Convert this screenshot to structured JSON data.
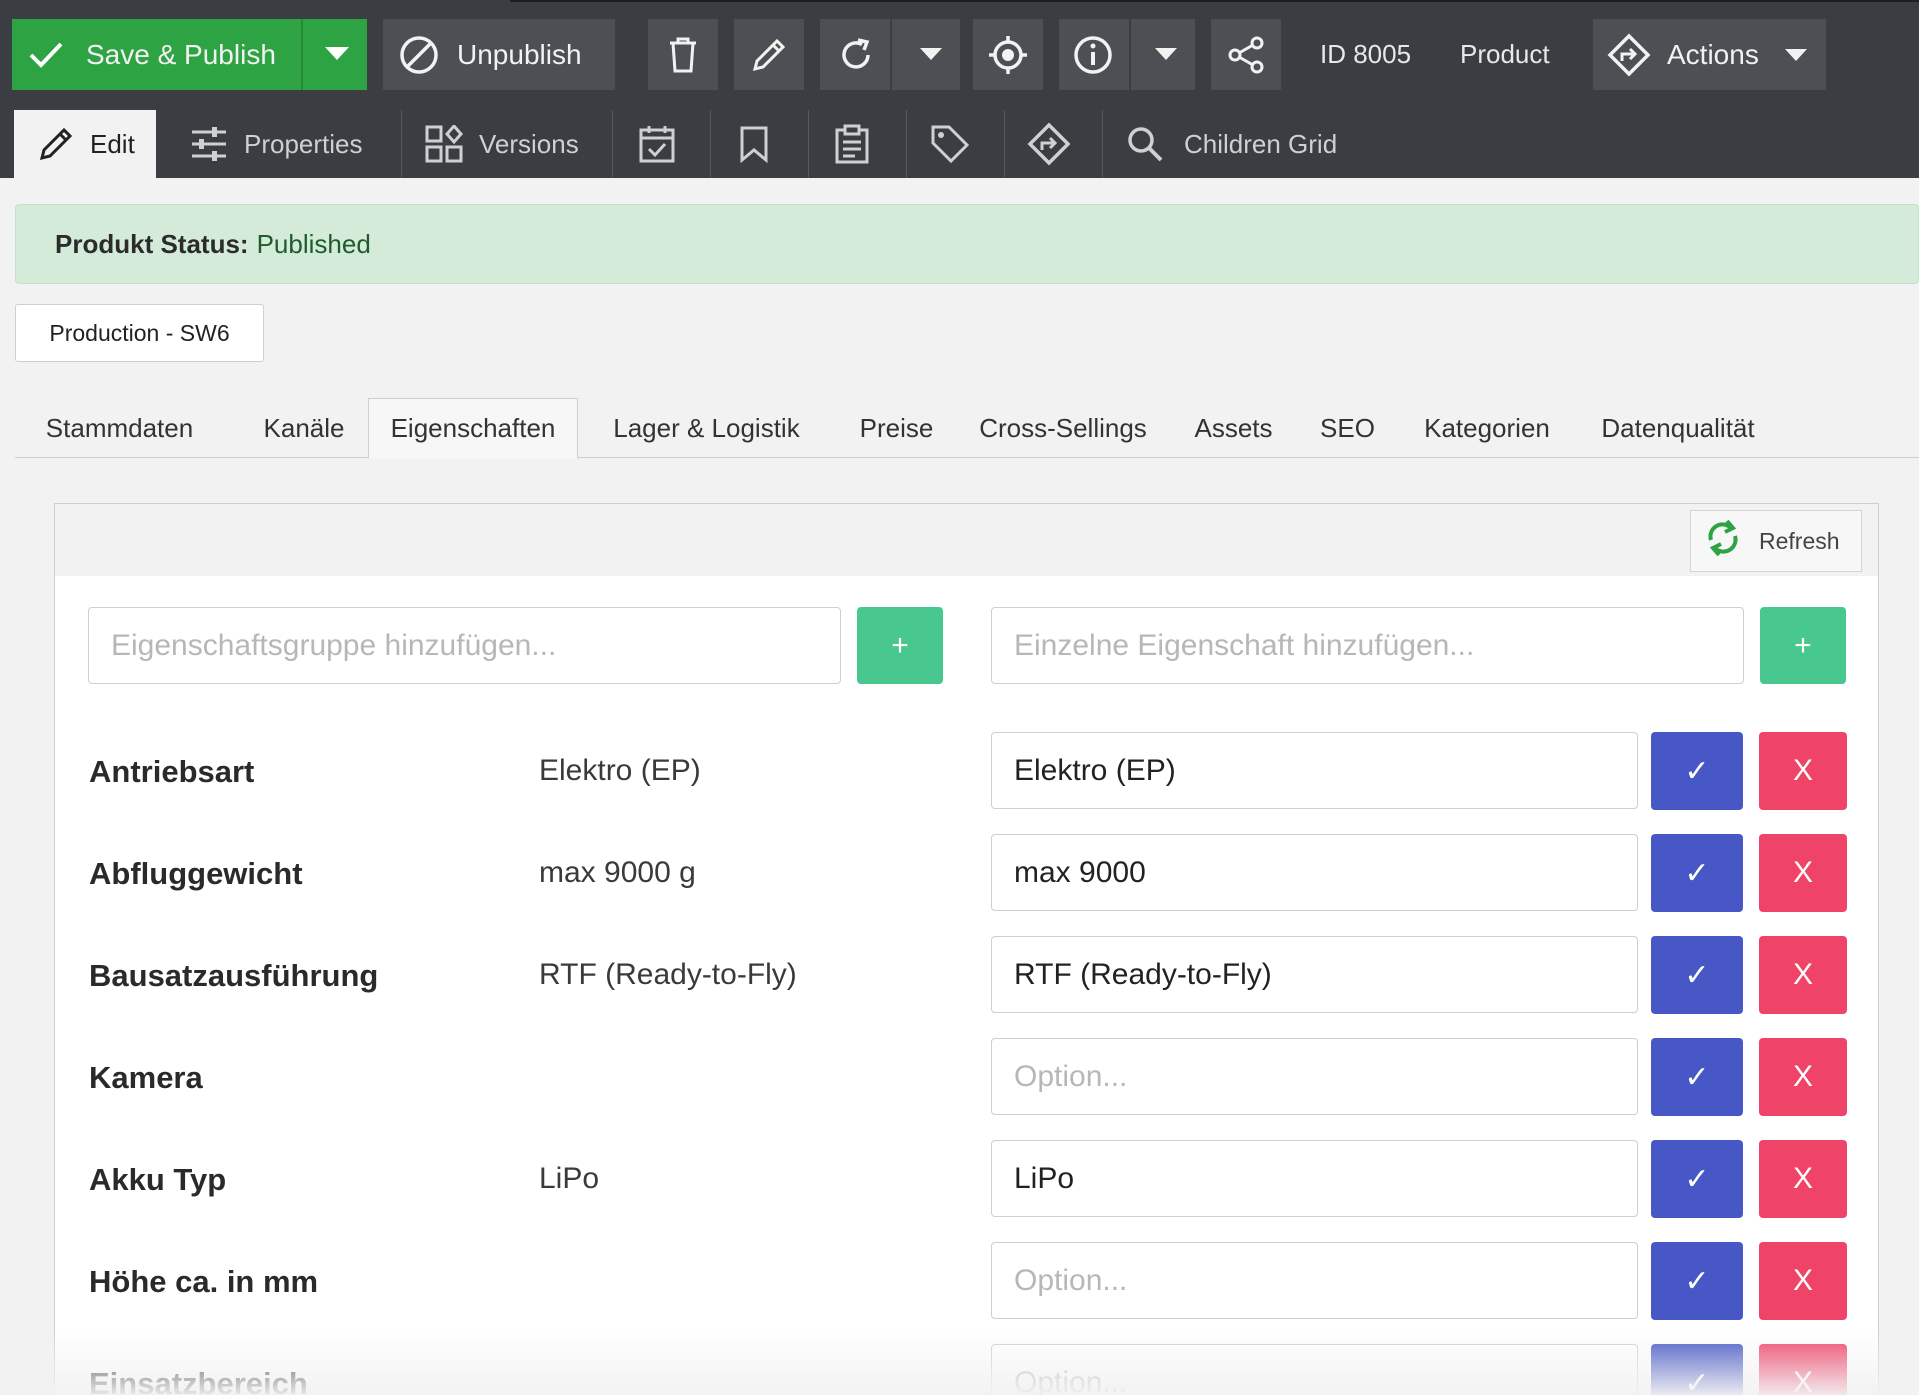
{
  "toolbar": {
    "save_publish_label": "Save & Publish",
    "unpublish_label": "Unpublish",
    "id_label": "ID 8005",
    "type_label": "Product",
    "actions_label": "Actions",
    "save_color": "#2ea343"
  },
  "editor_tabs": {
    "edit": "Edit",
    "properties": "Properties",
    "versions": "Versions",
    "children_grid": "Children Grid"
  },
  "status": {
    "label": "Produkt Status:",
    "value": "Published"
  },
  "tag": "Production - SW6",
  "section_tabs": [
    "Stammdaten",
    "Kanäle",
    "Eigenschaften",
    "Lager & Logistik",
    "Preise",
    "Cross-Sellings",
    "Assets",
    "SEO",
    "Kategorien",
    "Datenqualität"
  ],
  "active_section_tab": "Eigenschaften",
  "panel": {
    "refresh_label": "Refresh",
    "group_placeholder": "Eigenschaftsgruppe hinzufügen...",
    "single_placeholder": "Einzelne Eigenschaft hinzufügen...",
    "add_label": "+",
    "confirm_label": "✓",
    "remove_label": "X",
    "option_placeholder": "Option..."
  },
  "properties": [
    {
      "name": "Antriebsart",
      "value": "Elektro (EP)",
      "input": "Elektro (EP)"
    },
    {
      "name": "Abfluggewicht",
      "value": "max 9000 g",
      "input": "max 9000"
    },
    {
      "name": "Bausatzausführung",
      "value": "RTF (Ready-to-Fly)",
      "input": "RTF (Ready-to-Fly)"
    },
    {
      "name": "Kamera",
      "value": "",
      "input": ""
    },
    {
      "name": "Akku Typ",
      "value": "LiPo",
      "input": "LiPo"
    },
    {
      "name": "Höhe ca. in mm",
      "value": "",
      "input": ""
    },
    {
      "name": "Einsatzbereich",
      "value": "",
      "input": ""
    }
  ]
}
